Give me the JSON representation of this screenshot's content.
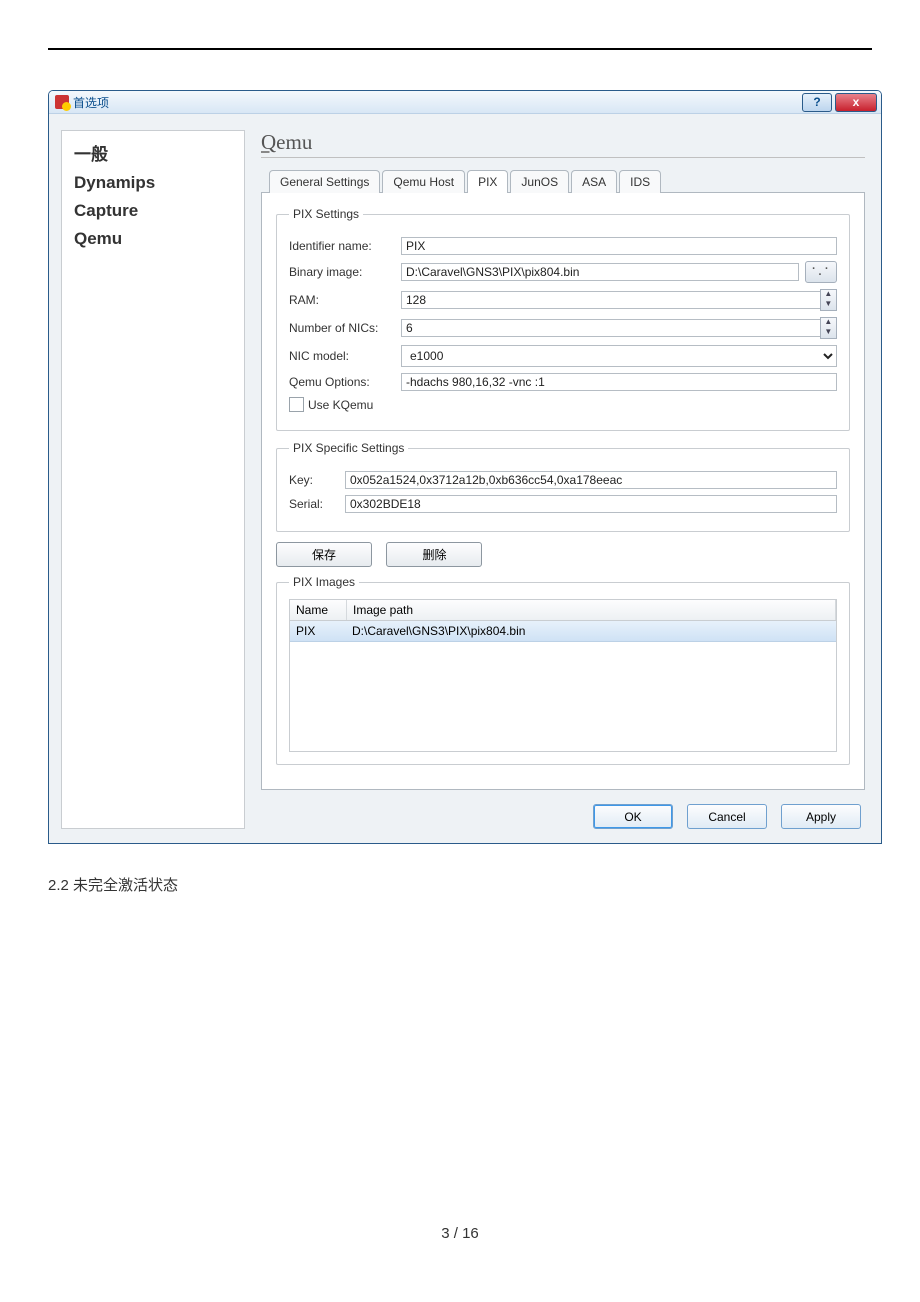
{
  "document": {
    "caption": "2.2 未完全激活状态",
    "page_footer": "3 / 16"
  },
  "window": {
    "title": "首选项"
  },
  "sidebar": {
    "items": [
      "一般",
      "Dynamips",
      "Capture",
      "Qemu"
    ]
  },
  "main": {
    "heading": "Qemu",
    "heading_underline": "Q",
    "tabs": [
      "General Settings",
      "Qemu Host",
      "PIX",
      "JunOS",
      "ASA",
      "IDS"
    ],
    "settings": {
      "legend": "PIX Settings",
      "identifier_name": {
        "label": "Identifier name:",
        "value": "PIX"
      },
      "binary_image": {
        "label": "Binary image:",
        "value": "D:\\Caravel\\GNS3\\PIX\\pix804.bin"
      },
      "ram": {
        "label": "RAM:",
        "value": "128"
      },
      "num_nics": {
        "label": "Number of NICs:",
        "value": "6"
      },
      "nic_model": {
        "label": "NIC model:",
        "value": "e1000"
      },
      "qemu_options": {
        "label": "Qemu Options:",
        "value": "-hdachs 980,16,32 -vnc :1"
      },
      "use_kqemu": {
        "label": "Use KQemu",
        "checked": false
      }
    },
    "specific": {
      "legend": "PIX Specific Settings",
      "key": {
        "label": "Key:",
        "value": "0x052a1524,0x3712a12b,0xb636cc54,0xa178eeac"
      },
      "serial": {
        "label": "Serial:",
        "value": "0x302BDE18"
      }
    },
    "buttons": {
      "save": "保存",
      "delete": "删除"
    },
    "images": {
      "legend": "PIX Images",
      "headers": {
        "name": "Name",
        "path": "Image path"
      },
      "rows": [
        {
          "name": "PIX",
          "path": "D:\\Caravel\\GNS3\\PIX\\pix804.bin"
        }
      ]
    }
  },
  "dialog_buttons": {
    "ok": "OK",
    "cancel": "Cancel",
    "apply": "Apply"
  }
}
